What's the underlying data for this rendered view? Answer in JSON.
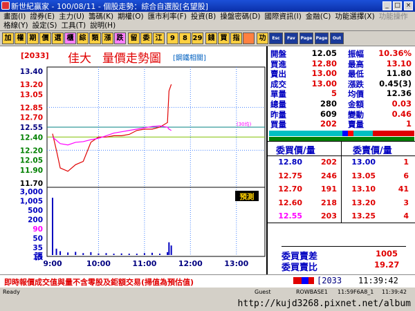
{
  "window": {
    "title": "新世紀贏家 - 100/08/11 - 個股走勢：綜合自選股[名望股]",
    "buttons": [
      "_",
      "□",
      "×"
    ]
  },
  "menu": {
    "row1": [
      "畫面(I)",
      "證券(E)",
      "主力(U)",
      "籌碼(K)",
      "期權(O)",
      "匯市利率(F)",
      "投資(B)",
      "操盤密碼(D)",
      "國際資訊(I)",
      "金融(C)",
      "功能選擇(X)"
    ],
    "row1_disabled": "功能操作",
    "row2": [
      "格線(Y)",
      "設定(S)",
      "工具(T)",
      "說明(H)"
    ]
  },
  "toolbar": {
    "buttons": [
      "加",
      "權",
      "期",
      "價",
      "選",
      "櫃",
      "綜",
      "類",
      "漲",
      "跌",
      "留",
      "委",
      "江",
      "9",
      "8",
      "29",
      "錢",
      "買",
      "指",
      "",
      "功",
      "Esc",
      "Fav",
      "Page",
      "Page",
      "Out"
    ]
  },
  "chart": {
    "code": "[2033]",
    "name": "佳大",
    "title": "量價走勢圖",
    "industry": "[鋼鐵相關]",
    "ma_label": "(30均)",
    "preview_label": "預測",
    "price_ticks": [
      "13.40",
      "13.20",
      "13.05",
      "12.85",
      "12.70",
      "12.55",
      "12.40",
      "12.20",
      "12.05",
      "11.90",
      "11.70"
    ],
    "volume_ticks": [
      "3,000",
      "1,005",
      "500",
      "200",
      "90",
      "50",
      "35",
      "15"
    ],
    "volume_unit": "張",
    "time_ticks": [
      "9:00",
      "10:00",
      "11:00",
      "12:00",
      "13:00"
    ]
  },
  "chart_data": {
    "type": "line",
    "ylim": [
      11.7,
      13.4
    ],
    "x": [
      "09:00",
      "09:05",
      "09:10",
      "09:20",
      "09:30",
      "09:40",
      "09:50",
      "10:00",
      "10:10",
      "10:20",
      "10:30",
      "10:40",
      "10:50",
      "11:00",
      "11:10",
      "11:20",
      "11:30",
      "11:32",
      "11:35"
    ],
    "series": [
      {
        "values": [
          12.45,
          12.2,
          11.93,
          11.88,
          11.98,
          12.03,
          12.32,
          12.4,
          12.4,
          12.42,
          12.42,
          12.44,
          12.5,
          12.52,
          12.52,
          12.55,
          12.62,
          13.1,
          13.2
        ],
        "color": "#e00000"
      },
      {
        "values": [
          12.4,
          12.35,
          12.3,
          12.28,
          12.32,
          12.33,
          12.36,
          12.38,
          12.42,
          12.46,
          12.48,
          12.5,
          12.52,
          12.54,
          12.56,
          12.57,
          12.55,
          12.52,
          12.5
        ],
        "color": "#ff00ff"
      }
    ],
    "volume": [
      180,
      20,
      12,
      8,
      10,
      6,
      9,
      5,
      6,
      4,
      5,
      4,
      3,
      6,
      7,
      4,
      9,
      40,
      30
    ]
  },
  "quote": {
    "rows": [
      {
        "l1": "開盤",
        "v1": "12.05",
        "l2": "振幅",
        "v2": "10.36%",
        "c1": "#000",
        "c2": "#e00000"
      },
      {
        "l1": "買進",
        "v1": "12.80",
        "l2": "最高",
        "v2": "13.10",
        "c1": "#e00000",
        "c2": "#e00000"
      },
      {
        "l1": "賣出",
        "v1": "13.00",
        "l2": "最低",
        "v2": "11.80",
        "c1": "#e00000",
        "c2": "#000"
      },
      {
        "l1": "成交",
        "v1": "13.00",
        "l2": "漲跌",
        "v2": "0.45(3)",
        "c1": "#e00000",
        "c2": "#000"
      },
      {
        "l1": "單量",
        "v1": "5",
        "l2": "均價",
        "v2": "12.36",
        "c1": "#e00000",
        "c2": "#000"
      },
      {
        "l1": "總量",
        "v1": "280",
        "l2": "金額",
        "v2": "0.03",
        "c1": "#000",
        "c2": "#e00000"
      },
      {
        "l1": "昨量",
        "v1": "609",
        "l2": "變動",
        "v2": "0.46",
        "c1": "#000",
        "c2": "#e00000"
      },
      {
        "l1": "買量",
        "v1": "202",
        "l2": "賣量",
        "v2": "1",
        "c1": "#e00000",
        "c2": "#e00000"
      }
    ],
    "bid_header": "委買價/量",
    "ask_header": "委賣價/量",
    "bids": [
      [
        "12.80",
        "202"
      ],
      [
        "12.75",
        "246"
      ],
      [
        "12.70",
        "191"
      ],
      [
        "12.60",
        "218"
      ],
      [
        "12.55",
        "203"
      ]
    ],
    "asks": [
      [
        "13.00",
        "1"
      ],
      [
        "13.05",
        "6"
      ],
      [
        "13.10",
        "41"
      ],
      [
        "13.20",
        "3"
      ],
      [
        "13.25",
        "4"
      ]
    ],
    "diff_label": "委買賣差",
    "diff_value": "1005",
    "ratio_label": "委買賣比",
    "ratio_value": "19.27"
  },
  "notice": {
    "text": "即時報價成交值與量不含零股及鉅額交易(掃值為預估值)",
    "code_box": "[2033",
    "time": "11:39:42"
  },
  "status": {
    "left": "Ready",
    "mid1": "Guest",
    "mid2": "ROWBASE1",
    "mid3": "11:59F6A8_1",
    "right": "11:39:42"
  },
  "watermark": {
    "url": "http://kujd3268.pixnet.net/album"
  }
}
